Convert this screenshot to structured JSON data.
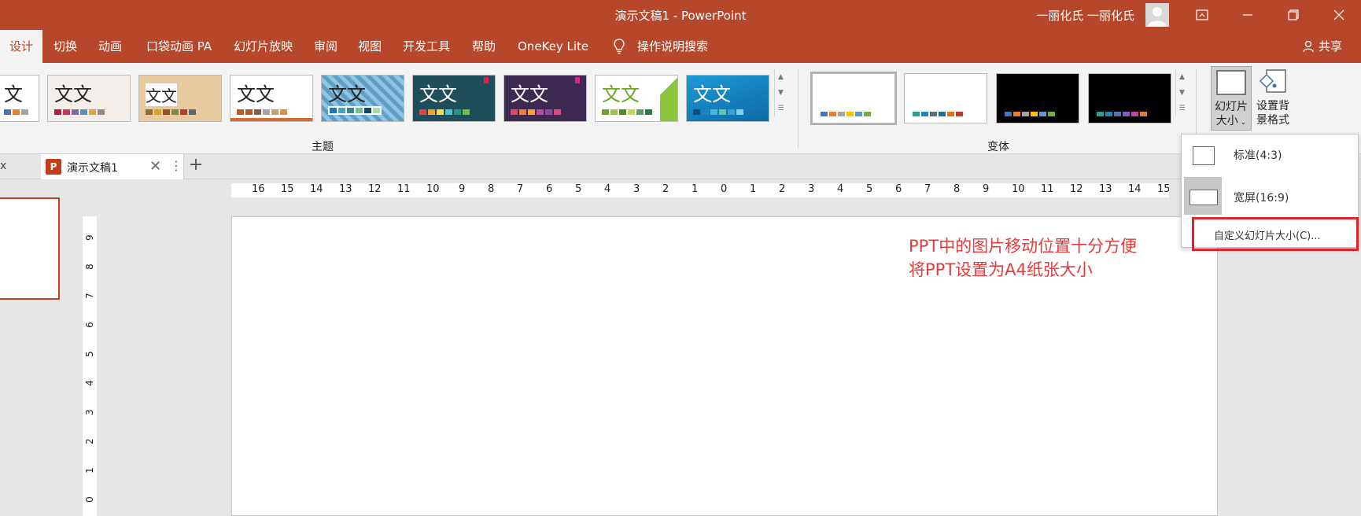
{
  "window": {
    "title": "演示文稿1  -  PowerPoint",
    "user": "一丽化氏 一丽化氏",
    "buttons": [
      "ribbon-display-options",
      "minimize",
      "restore",
      "close"
    ]
  },
  "ribbon_tabs": [
    {
      "label": "设计",
      "active": true
    },
    {
      "label": "切换"
    },
    {
      "label": "动画"
    },
    {
      "label": "口袋动画 PA"
    },
    {
      "label": "幻灯片放映"
    },
    {
      "label": "审阅"
    },
    {
      "label": "视图"
    },
    {
      "label": "开发工具"
    },
    {
      "label": "帮助"
    },
    {
      "label": "OneKey Lite"
    },
    {
      "label": "操作说明搜索",
      "icon": "lightbulb-icon"
    }
  ],
  "share_label": "共享",
  "themes": {
    "group_label": "主题",
    "items": [
      {
        "text": "文",
        "bg": "#ffffff",
        "fg": "#222"
      },
      {
        "text": "文文",
        "bg": "#f4eeea",
        "fg": "#222"
      },
      {
        "text": "文文",
        "bg": "#e9c9a0",
        "fg": "#222"
      },
      {
        "text": "文文",
        "bg": "#ffffff",
        "fg": "#222"
      },
      {
        "text": "文文",
        "bg": "#5f9fc6",
        "fg": "#222"
      },
      {
        "text": "文文",
        "bg": "#1f4e5a",
        "fg": "#ffffff"
      },
      {
        "text": "文文",
        "bg": "#3d2a52",
        "fg": "#ffffff"
      },
      {
        "text": "文文",
        "bg": "#ffffff",
        "fg": "#6aa624"
      },
      {
        "text": "文文",
        "bg": "#1d9ad6",
        "fg": "#ffffff"
      }
    ]
  },
  "variants": {
    "group_label": "变体",
    "items": [
      {
        "bg": "#ffffff",
        "selected": true
      },
      {
        "bg": "#ffffff"
      },
      {
        "bg": "#000000"
      },
      {
        "bg": "#000000"
      }
    ]
  },
  "customize": {
    "slide_size_label_1": "幻灯片",
    "slide_size_label_2": "大小",
    "format_bg_label_1": "设置背",
    "format_bg_label_2": "景格式"
  },
  "doc_tab": {
    "name": "演示文稿1"
  },
  "ruler_h": [
    "16",
    "15",
    "14",
    "13",
    "12",
    "11",
    "10",
    "9",
    "8",
    "7",
    "6",
    "5",
    "4",
    "3",
    "2",
    "1",
    "0",
    "1",
    "2",
    "3",
    "4",
    "5",
    "6",
    "7",
    "8",
    "9",
    "10",
    "11",
    "12",
    "13",
    "14",
    "15"
  ],
  "ruler_v": [
    "9",
    "8",
    "7",
    "6",
    "5",
    "4",
    "3",
    "2",
    "1",
    "0"
  ],
  "note": {
    "line1": "PPT中的图片移动位置十分方便",
    "line2": "将PPT设置为A4纸张大小",
    "color": "#e23c3c"
  },
  "slide_size_menu": {
    "items": [
      {
        "label": "标准(4:3)"
      },
      {
        "label": "宽屏(16:9)",
        "selected": true
      },
      {
        "label": "自定义幻灯片大小(C)...",
        "highlighted": true
      }
    ]
  },
  "colors": {
    "accent": "#b7472a",
    "highlight_box": "#e0232a"
  }
}
